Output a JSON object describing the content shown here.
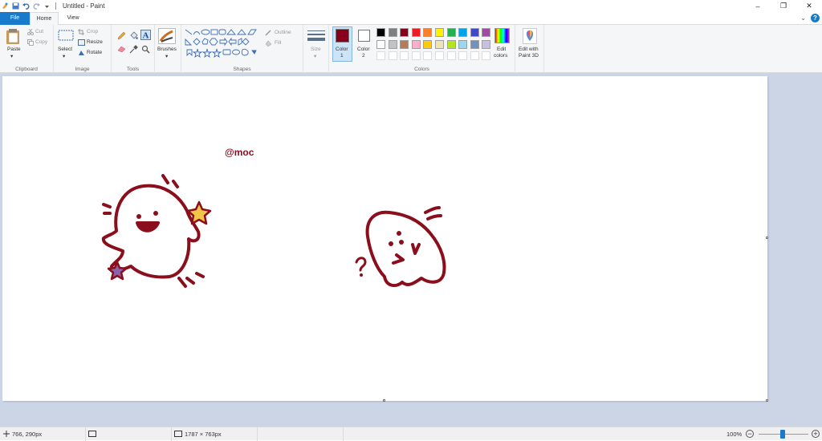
{
  "window": {
    "title": "Untitled - Paint",
    "minimize_glyph": "–",
    "restore_glyph": "❐",
    "close_glyph": "✕"
  },
  "tabs": {
    "file": "File",
    "home": "Home",
    "view": "View"
  },
  "ribbon": {
    "collapse_glyph": "⌄",
    "help_glyph": "?",
    "clipboard": {
      "label": "Clipboard",
      "paste": "Paste",
      "cut": "Cut",
      "copy": "Copy"
    },
    "image": {
      "label": "Image",
      "select": "Select",
      "crop": "Crop",
      "resize": "Resize",
      "rotate": "Rotate"
    },
    "tools": {
      "label": "Tools"
    },
    "brushes": {
      "label": "Brushes"
    },
    "shapes": {
      "label": "Shapes",
      "outline": "Outline",
      "fill": "Fill"
    },
    "size": {
      "label": "Size"
    },
    "colors": {
      "label": "Colors",
      "color1": "Color",
      "color1_num": "1",
      "color2": "Color",
      "color2_num": "2",
      "edit_colors_1": "Edit",
      "edit_colors_2": "colors",
      "edit_paint3d_1": "Edit with",
      "edit_paint3d_2": "Paint 3D",
      "color1_value": "#88001b",
      "color2_value": "#ffffff",
      "palette_row1": [
        "#000000",
        "#7f7f7f",
        "#88001b",
        "#ed1c24",
        "#ff7f27",
        "#fff200",
        "#22b14c",
        "#00a2e8",
        "#3f48cc",
        "#a349a4"
      ],
      "palette_row2": [
        "#ffffff",
        "#c3c3c3",
        "#b97a57",
        "#ffaec9",
        "#ffc90e",
        "#efe4b0",
        "#b5e61d",
        "#99d9ea",
        "#7092be",
        "#c8bfe7"
      ]
    }
  },
  "canvas": {
    "caption": "@moc",
    "drawing_color": "#8b0e1c"
  },
  "status": {
    "cursor_pos": "766, 290px",
    "canvas_size": "1787 × 763px",
    "zoom": "100%",
    "zoom_out_glyph": "−",
    "zoom_in_glyph": "+"
  }
}
